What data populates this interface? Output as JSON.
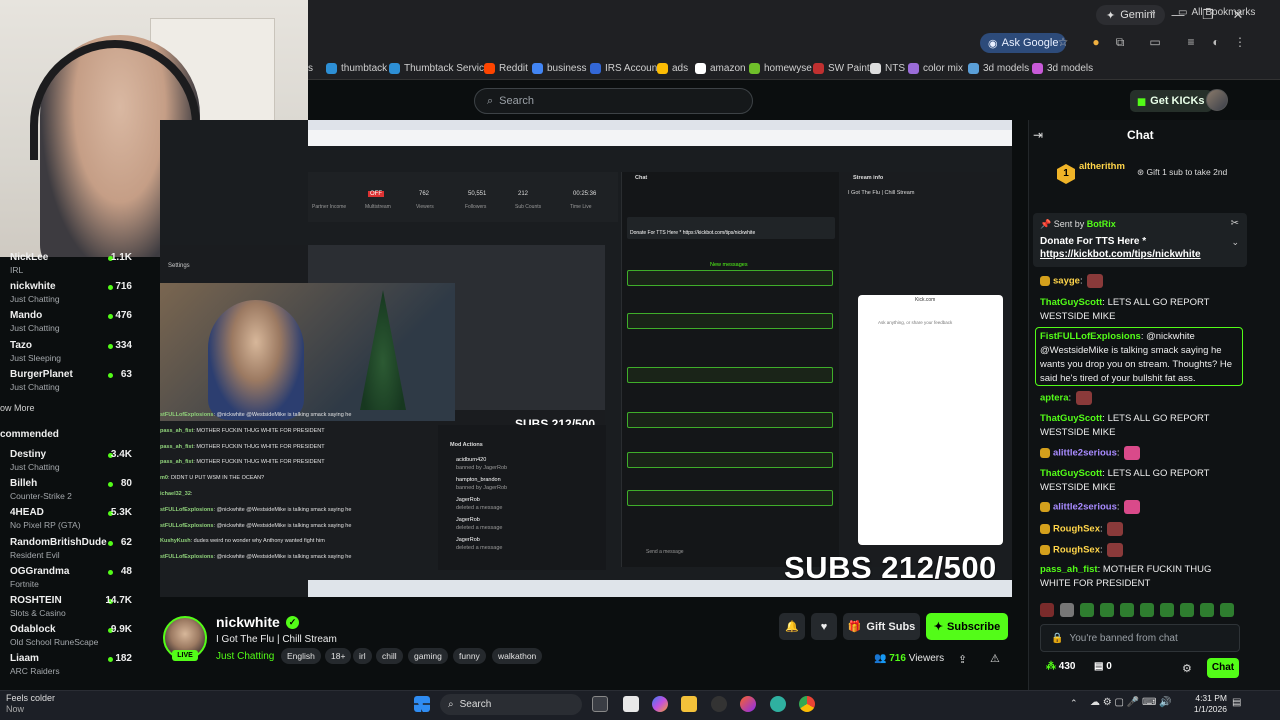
{
  "browser": {
    "gemini_label": "Gemini",
    "ask_google_label": "Ask Google",
    "bookmarks": [
      {
        "label": "s",
        "color": "#888888"
      },
      {
        "label": "thumbtack",
        "color": "#2d8fd5"
      },
      {
        "label": "Thumbtack Services",
        "color": "#2d8fd5"
      },
      {
        "label": "Reddit",
        "color": "#ff4500"
      },
      {
        "label": "business",
        "color": "#4285f4"
      },
      {
        "label": "IRS Account",
        "color": "#3367d6"
      },
      {
        "label": "ads",
        "color": "#fbbc04"
      },
      {
        "label": "amazon",
        "color": "#ffffff"
      },
      {
        "label": "homewyse",
        "color": "#6fbf2a"
      },
      {
        "label": "SW Paint",
        "color": "#c03030"
      },
      {
        "label": "NTS",
        "color": "#dddddd"
      },
      {
        "label": "color mix",
        "color": "#9a6cd8"
      },
      {
        "label": "3d models",
        "color": "#5a9fd8"
      },
      {
        "label": "3d models",
        "color": "#c85ad8"
      }
    ],
    "all_bookmarks_label": "All Bookmarks"
  },
  "header": {
    "search_placeholder": "Search",
    "get_kicks_label": "Get KICKs"
  },
  "sidebar": {
    "channels": [
      {
        "name": "NickLee",
        "category": "IRL",
        "viewers": "1.1K"
      },
      {
        "name": "nickwhite",
        "category": "Just Chatting",
        "viewers": "716"
      },
      {
        "name": "Mando",
        "category": "Just Chatting",
        "viewers": "476"
      },
      {
        "name": "Tazo",
        "category": "Just Sleeping",
        "viewers": "334"
      },
      {
        "name": "BurgerPlanet",
        "category": "Just Chatting",
        "viewers": "63"
      }
    ],
    "show_more_label": "ow More",
    "recommended_label": "commended",
    "recommended": [
      {
        "name": "Destiny",
        "category": "Just Chatting",
        "viewers": "3.4K"
      },
      {
        "name": "Billeh",
        "category": "Counter-Strike 2",
        "viewers": "80"
      },
      {
        "name": "4HEAD",
        "category": "No Pixel RP (GTA)",
        "viewers": "5.3K"
      },
      {
        "name": "RandomBritishDude",
        "category": "Resident Evil",
        "viewers": "62"
      },
      {
        "name": "OGGrandma",
        "category": "Fortnite",
        "viewers": "48"
      },
      {
        "name": "ROSHTEIN",
        "category": "Slots & Casino",
        "viewers": "14.7K"
      },
      {
        "name": "Odablock",
        "category": "Old School RuneScape",
        "viewers": "9.9K"
      },
      {
        "name": "Liaam",
        "category": "ARC Raiders",
        "viewers": "182"
      },
      {
        "name": "",
        "category": "",
        "viewers": ""
      }
    ]
  },
  "video": {
    "subs_small": "SUBS 212/500",
    "subs_big": "SUBS 212/500",
    "settings_label": "Settings",
    "stats": [
      {
        "value": "",
        "label": "Partner Income"
      },
      {
        "value": "OFF",
        "label": "Multistream"
      },
      {
        "value": "762",
        "label": "Viewers"
      },
      {
        "value": "50,551",
        "label": "Followers"
      },
      {
        "value": "212",
        "label": "Sub Counts"
      },
      {
        "value": "00:25:36",
        "label": "Time Live"
      }
    ],
    "inner_chat": [
      {
        "user": "stFULLofExplosions",
        "text": ": @nickwhite @WestsideMike is talking smack saying he"
      },
      {
        "user": "pass_ah_fist",
        "text": ": MOTHER FUCKIN THUG WHITE FOR PRESIDENT"
      },
      {
        "user": "pass_ah_fist",
        "text": ": MOTHER FUCKIN THUG WHITE FOR PRESIDENT"
      },
      {
        "user": "pass_ah_fist",
        "text": ": MOTHER FUCKIN THUG WHITE FOR PRESIDENT"
      },
      {
        "user": "m0",
        "text": ": DIDNT U PUT WSM IN THE OCEAN?"
      },
      {
        "user": "ichael32_32",
        "text": ":"
      },
      {
        "user": "stFULLofExplosions",
        "text": ": @nickwhite @WestsideMike is talking smack saying he"
      },
      {
        "user": "stFULLofExplosions",
        "text": ": @nickwhite @WestsideMike is talking smack saying he"
      },
      {
        "user": "KushyKush",
        "text": ": dudes weird no wonder why Anthony wanted fight him"
      },
      {
        "user": "stFULLofExplosions",
        "text": ": @nickwhite @WestsideMike is talking smack saying he"
      }
    ],
    "mod_actions_title": "Mod Actions",
    "mod_actions": [
      {
        "user": "acidburn420",
        "detail": "banned by JagerRob"
      },
      {
        "user": "hampton_brandon",
        "detail": "banned by JagerRob"
      },
      {
        "user": "JagerRob",
        "detail": "deleted a message"
      },
      {
        "user": "JagerRob",
        "detail": "deleted a message"
      },
      {
        "user": "JagerRob",
        "detail": "deleted a message"
      }
    ],
    "chat_title": "Chat",
    "new_messages_label": "New messages",
    "donate_text": "Donate For TTS Here * https://kickbot.com/tips/nickwhite",
    "stream_info_title": "Stream info",
    "stream_info_name": "I Got The Flu | Chill Stream",
    "popup_domain": "Kick.com",
    "popup_placeholder": "Ask anything, or share your feedback",
    "send_message_placeholder": "Send a message"
  },
  "stream": {
    "streamer": "nickwhite",
    "live_label": "LIVE",
    "title": "I Got The Flu | Chill Stream",
    "category": "Just Chatting",
    "tags": [
      "English",
      "18+",
      "irl",
      "chill",
      "gaming",
      "funny",
      "walkathon"
    ],
    "gift_subs_label": "Gift Subs",
    "subscribe_label": "Subscribe",
    "viewer_count": "716",
    "viewers_label": "Viewers"
  },
  "chat": {
    "title": "Chat",
    "gift_user": "altherithm",
    "gift_count": "1",
    "gift_text": "Gift 1 sub to take 2nd",
    "pinned_sender_label": "Sent by",
    "pinned_sender": "BotRix",
    "pinned_text": "Donate For TTS Here *",
    "pinned_link": "https://kickbot.com/tips/nickwhite",
    "messages": [
      {
        "user": "sayge",
        "text": "",
        "color": "#ffd54a",
        "emote": true
      },
      {
        "user": "ThatGuyScott",
        "text": "LETS ALL GO REPORT WESTSIDE MIKE",
        "color": "#53fc18",
        "emote": false
      },
      {
        "user": "FistFULLofExplosions",
        "text": "@nickwhite @WestsideMike is talking smack saying he wants you drop you on stream. Thoughts? He said he's tired of your bullshit fat ass.",
        "color": "#53fc18",
        "emote": false
      },
      {
        "user": "aptera",
        "text": "",
        "color": "#53fc18",
        "emote": true
      },
      {
        "user": "ThatGuyScott",
        "text": "LETS ALL GO REPORT WESTSIDE MIKE",
        "color": "#53fc18",
        "emote": false
      },
      {
        "user": "alittle2serious",
        "text": "",
        "color": "#a88bff",
        "emote": true
      },
      {
        "user": "ThatGuyScott",
        "text": "LETS ALL GO REPORT WESTSIDE MIKE",
        "color": "#53fc18",
        "emote": false
      },
      {
        "user": "alittle2serious",
        "text": "",
        "color": "#a88bff",
        "emote": true
      },
      {
        "user": "RoughSex",
        "text": "",
        "color": "#ffd54a",
        "emote": true
      },
      {
        "user": "RoughSex",
        "text": "",
        "color": "#ffd54a",
        "emote": true
      },
      {
        "user": "pass_ah_fist",
        "text": "MOTHER FUCKIN THUG WHITE FOR PRESIDENT",
        "color": "#53fc18",
        "emote": false
      }
    ],
    "input_placeholder": "You're banned from chat",
    "kick_points": "430",
    "chest_count": "0",
    "send_label": "Chat"
  },
  "taskbar": {
    "weather_line1": "Feels colder",
    "weather_line2": "Now",
    "search_label": "Search",
    "time": "4:31 PM",
    "date": "1/1/2026"
  },
  "colors": {
    "accent": "#53fc18",
    "background": "#0b0e0f"
  }
}
